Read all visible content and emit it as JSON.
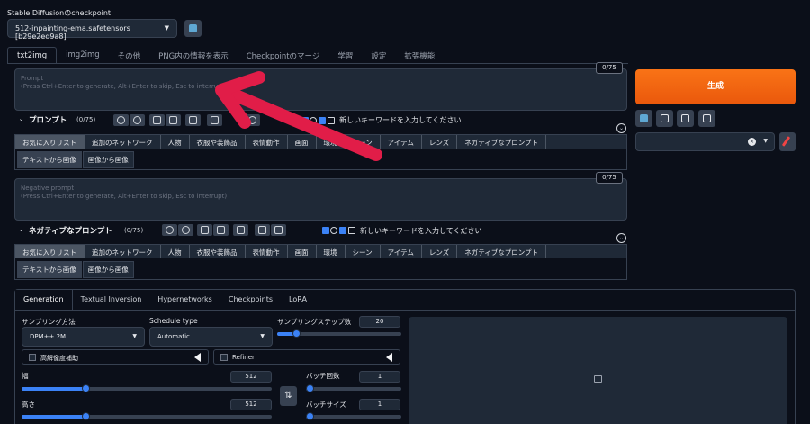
{
  "checkpoint": {
    "label": "Stable Diffusionのcheckpoint",
    "value": "512-inpainting-ema.safetensors [b29e2ed9a8]"
  },
  "main_tabs": [
    "txt2img",
    "img2img",
    "その他",
    "PNG内の情報を表示",
    "Checkpointのマージ",
    "学習",
    "設定",
    "拡張機能"
  ],
  "prompt": {
    "placeholder_title": "Prompt",
    "placeholder_hint": "(Press Ctrl+Enter to generate, Alt+Enter to skip, Esc to interrupt)",
    "counter": "0/75",
    "section_title": "プロンプト",
    "section_count": "(0/75)",
    "keyword_placeholder": "新しいキーワードを入力してください"
  },
  "negative": {
    "placeholder_title": "Negative prompt",
    "placeholder_hint": "(Press Ctrl+Enter to generate, Alt+Enter to skip, Esc to interrupt)",
    "counter": "0/75",
    "section_title": "ネガティブなプロンプト",
    "section_count": "(0/75)",
    "keyword_placeholder": "新しいキーワードを入力してください"
  },
  "categories_prompt": [
    "お気に入りリスト",
    "追加のネットワーク",
    "人物",
    "衣服や装飾品",
    "表情動作",
    "画面",
    "環境",
    "シーン",
    "アイテム",
    "レンズ",
    "ネガティブなプロンプト"
  ],
  "categories_negative": [
    "お気に入りリスト",
    "追加のネットワーク",
    "人物",
    "衣服や装飾品",
    "表情動作",
    "画面",
    "環境",
    "シーン",
    "アイテム",
    "レンズ",
    "ネガティブなプロンプト"
  ],
  "sub_tabs": [
    "テキストから画像",
    "画像から画像"
  ],
  "generate_label": "生成",
  "panel_tabs": [
    "Generation",
    "Textual Inversion",
    "Hypernetworks",
    "Checkpoints",
    "LoRA"
  ],
  "sampling": {
    "method_label": "サンプリング方法",
    "method_value": "DPM++ 2M",
    "schedule_label": "Schedule type",
    "schedule_value": "Automatic",
    "steps_label": "サンプリングステップ数",
    "steps_value": "20",
    "steps_level": 0.13
  },
  "hires_label": "高解像度補助",
  "refiner_label": "Refiner",
  "width": {
    "label": "幅",
    "value": "512",
    "level": 0.25
  },
  "height": {
    "label": "高さ",
    "value": "512",
    "level": 0.25
  },
  "batch_count": {
    "label": "バッチ回数",
    "value": "1",
    "level": 0.0
  },
  "batch_size": {
    "label": "バッチサイズ",
    "value": "1",
    "level": 0.0
  },
  "colors": {
    "accent": "#3b82f6",
    "generate": "#f97316",
    "arrow": "#e11d48"
  }
}
